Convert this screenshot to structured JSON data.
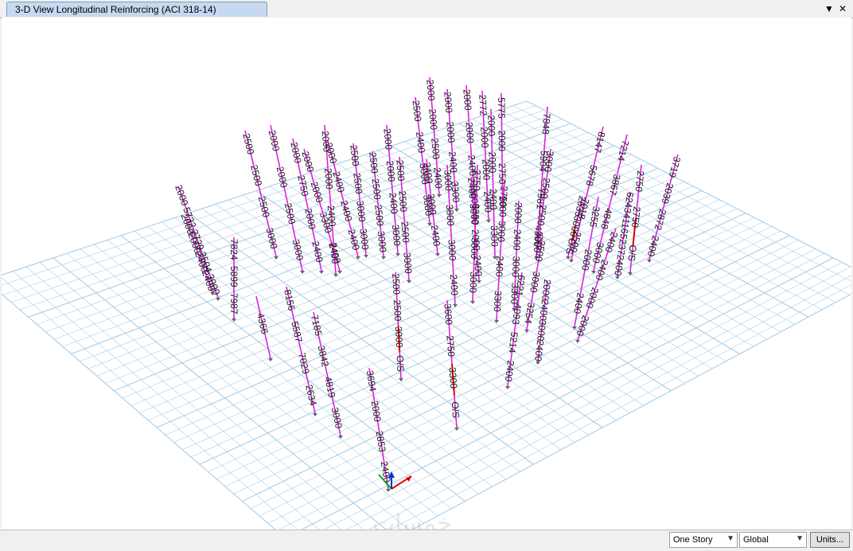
{
  "window": {
    "tab_title": "3-D View  Longitudinal Reinforcing  (ACI 318-14)",
    "dropdown_icon": "triangle-down",
    "close_icon": "x"
  },
  "statusbar": {
    "story_select": "One Story",
    "coord_select": "Global",
    "units_button": "Units..."
  },
  "watermark": "خمسات",
  "colors": {
    "column": "#e020e0",
    "overstressed": "#e00000",
    "grid": "#a7cdea",
    "tab": "#c6d9f1"
  },
  "axis_icons": [
    "x-axis-arrow",
    "y-axis-arrow",
    "z-axis-arrow"
  ],
  "columns": [
    {
      "labels": [
        "2000",
        "5732",
        "2729",
        "3504",
        "3000"
      ]
    },
    {
      "labels": [
        "2000",
        "2000",
        "2400",
        "2400"
      ]
    },
    {
      "labels": [
        "7824",
        "5899",
        "7987"
      ]
    },
    {
      "labels": [
        "4366"
      ]
    },
    {
      "labels": [
        "2500",
        "2500",
        "2500",
        "3000"
      ]
    },
    {
      "labels": [
        "2000",
        "2000",
        "2500",
        "3000"
      ]
    },
    {
      "labels": [
        "2000",
        "2750",
        "2000",
        "2400"
      ]
    },
    {
      "labels": [
        "2000",
        "2000",
        "3300",
        "2400"
      ]
    },
    {
      "labels": [
        "2000",
        "2000",
        "2400",
        "2400"
      ]
    },
    {
      "labels": [
        "2000",
        "2400",
        "2400",
        "2400"
      ]
    },
    {
      "labels": [
        "2500",
        "2500",
        "3000",
        "3000"
      ]
    },
    {
      "labels": [
        "2500",
        "2500",
        "2500",
        "3000"
      ]
    },
    {
      "labels": [
        "2000",
        "2000",
        "2400",
        "3000"
      ]
    },
    {
      "labels": [
        "2500",
        "2500",
        "2500",
        "3000"
      ]
    },
    {
      "labels": [
        "8156",
        "5587",
        "7029",
        "2634"
      ]
    },
    {
      "labels": [
        "7185",
        "3842",
        "4819",
        "3000"
      ]
    },
    {
      "labels": [
        "3694",
        "2000",
        "2853",
        "2400"
      ]
    },
    {
      "labels": [
        "2500",
        "2500",
        "3000",
        "O/S"
      ]
    },
    {
      "labels": [
        "2400",
        "3000",
        "2400"
      ]
    },
    {
      "labels": [
        "3000",
        "3800",
        "3000",
        "2400"
      ]
    },
    {
      "labels": [
        "3600",
        "2750",
        "3300",
        "O/S"
      ]
    },
    {
      "labels": [
        "2000",
        "2000",
        "2500",
        "2400"
      ]
    },
    {
      "labels": [
        "2500",
        "2400",
        "3000",
        "3000"
      ]
    },
    {
      "labels": [
        "2000",
        "2000",
        "2400",
        "3300"
      ]
    },
    {
      "labels": [
        "2000",
        "2000",
        "2400",
        "3000"
      ]
    },
    {
      "labels": [
        "2750",
        "3300",
        "3300",
        "3000"
      ]
    },
    {
      "labels": [
        "2772",
        "2000",
        "2000",
        "2400"
      ]
    },
    {
      "labels": [
        "2000",
        "2000",
        "2400",
        "3300"
      ]
    },
    {
      "labels": [
        "2400",
        "3000",
        "2000",
        "2400"
      ]
    },
    {
      "labels": [
        "2750",
        "3000",
        "2400",
        "3300"
      ]
    },
    {
      "labels": [
        "5775",
        "2000",
        "2750",
        "2000"
      ]
    },
    {
      "labels": [
        "7848",
        "5904",
        "7981",
        "4366"
      ]
    },
    {
      "labels": [
        "3000",
        "2500",
        "2500",
        "3000"
      ]
    },
    {
      "labels": [
        "2000",
        "2400",
        "3000",
        "3300"
      ]
    },
    {
      "labels": [
        "2500",
        "3000",
        "3254"
      ]
    },
    {
      "labels": [
        "6221",
        "4093",
        "5214",
        "2400"
      ]
    },
    {
      "labels": [
        "2000",
        "2400",
        "3000",
        "2400"
      ]
    },
    {
      "labels": [
        "8147",
        "5678",
        "7018",
        "2500"
      ]
    },
    {
      "labels": [
        "2635",
        "3000",
        "O/S"
      ]
    },
    {
      "labels": [
        "3255",
        "2000",
        "2400"
      ]
    },
    {
      "labels": [
        "7214",
        "3867",
        "4848",
        "3000"
      ]
    },
    {
      "labels": [
        "6243",
        "4116",
        "5237",
        "2400"
      ]
    },
    {
      "labels": [
        "2750",
        "2750",
        "O/S"
      ]
    },
    {
      "labels": [
        "3719",
        "2039",
        "2872",
        "2400"
      ]
    },
    {
      "labels": [
        "2400",
        "2400",
        "2000",
        "2000"
      ]
    }
  ]
}
